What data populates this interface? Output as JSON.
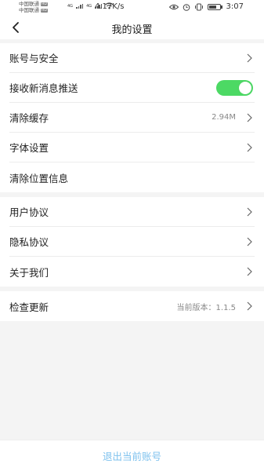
{
  "status_bar": {
    "carrier_1": "中国联通",
    "carrier_2": "中国联通",
    "carrier_badge": "HD",
    "network_1": "4G",
    "network_2": "4G",
    "speed": "4.17K/s",
    "time": "3:07",
    "icons": [
      "eye-icon",
      "alarm-icon",
      "vibrate-icon",
      "battery-icon"
    ]
  },
  "header": {
    "title": "我的设置",
    "back_icon": "chevron-left-icon"
  },
  "groups": [
    {
      "items": [
        {
          "label": "账号与安全",
          "type": "arrow"
        },
        {
          "label": "接收新消息推送",
          "type": "toggle",
          "on": true
        },
        {
          "label": "清除缓存",
          "type": "arrow",
          "value": "2.94M"
        },
        {
          "label": "字体设置",
          "type": "arrow"
        },
        {
          "label": "清除位置信息",
          "type": "plain"
        }
      ]
    },
    {
      "items": [
        {
          "label": "用户协议",
          "type": "arrow"
        },
        {
          "label": "隐私协议",
          "type": "arrow"
        },
        {
          "label": "关于我们",
          "type": "arrow"
        }
      ]
    },
    {
      "items": [
        {
          "label": "检查更新",
          "type": "arrow",
          "value": "当前版本：1.1.5"
        }
      ]
    }
  ],
  "footer": {
    "logout_label": "退出当前账号"
  },
  "colors": {
    "toggle_on": "#4cd964",
    "logout_text": "#7fc2ee",
    "background": "#f4f4f4"
  }
}
